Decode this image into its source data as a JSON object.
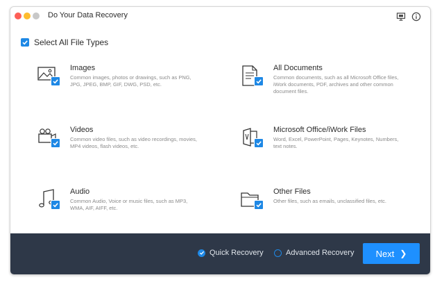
{
  "window": {
    "title": "Do Your Data Recovery"
  },
  "select_all": {
    "label": "Select All File Types",
    "checked": true
  },
  "file_types": [
    {
      "id": "images",
      "title": "Images",
      "description": "Common images, photos or drawings, such as PNG, JPG, JPEG, BMP, GIF, DWG, PSD, etc.",
      "icon": "image-icon",
      "checked": true
    },
    {
      "id": "all-documents",
      "title": "All Documents",
      "description": "Common documents, such as all Microsoft Office files, iWork documents, PDF, archives and other common document files.",
      "icon": "document-icon",
      "checked": true
    },
    {
      "id": "videos",
      "title": "Videos",
      "description": "Common video files, such as video recordings, movies, MP4 videos, flash videos, etc.",
      "icon": "video-camera-icon",
      "checked": true
    },
    {
      "id": "office-files",
      "title": "Microsoft Office/iWork Files",
      "description": "Word, Excel, PowerPoint, Pages, Keynotes, Numbers, text notes.",
      "icon": "office-icon",
      "checked": true
    },
    {
      "id": "audio",
      "title": "Audio",
      "description": "Common Audio, Voice or music files, such as MP3, WMA, AIF, AIFF, etc.",
      "icon": "music-note-icon",
      "checked": true
    },
    {
      "id": "other-files",
      "title": "Other Files",
      "description": "Other files, such as emails, unclassified files, etc.",
      "icon": "folder-icon",
      "checked": true
    }
  ],
  "footer": {
    "quick_recovery_label": "Quick Recovery",
    "advanced_recovery_label": "Advanced Recovery",
    "selected_mode": "Quick Recovery",
    "next_label": "Next",
    "next_icon": "chevron-right-icon"
  },
  "colors": {
    "accent": "#1e88e5",
    "footer_bg": "#2e3848",
    "next_button_bg": "#1e90ff"
  }
}
